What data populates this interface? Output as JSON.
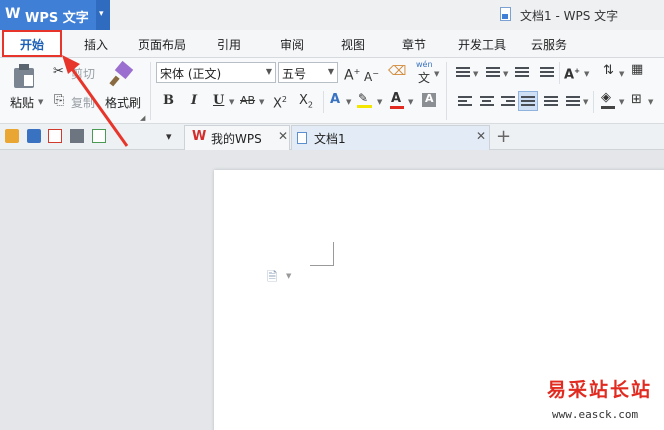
{
  "app": {
    "logo": "W",
    "name": "WPS 文字",
    "dropdown": "▾"
  },
  "window": {
    "title": "文档1 - WPS 文字"
  },
  "menu": {
    "active": "开始",
    "tabs": [
      "插入",
      "页面布局",
      "引用",
      "审阅",
      "视图",
      "章节",
      "开发工具",
      "云服务"
    ]
  },
  "ribbon": {
    "paste": "粘贴",
    "cut": "剪切",
    "copy": "复制",
    "format_painter": "格式刷",
    "font_name": "宋体 (正文)",
    "font_size": "五号",
    "bold": "B",
    "italic": "I",
    "underline": "U",
    "strike": "AB",
    "superscript": "X",
    "subscript": "X",
    "font_color_letter": "A",
    "wen_label": "wén"
  },
  "quickbar": {
    "tabs": [
      {
        "label": "我的WPS"
      },
      {
        "label": "文档1"
      }
    ],
    "new_tab": "+"
  },
  "watermark": {
    "text": "易采站长站",
    "url": "www.easck.com"
  },
  "colors": {
    "accent": "#3f7fd6",
    "highlight_box": "#e8352b",
    "arrow": "#e8352b"
  }
}
